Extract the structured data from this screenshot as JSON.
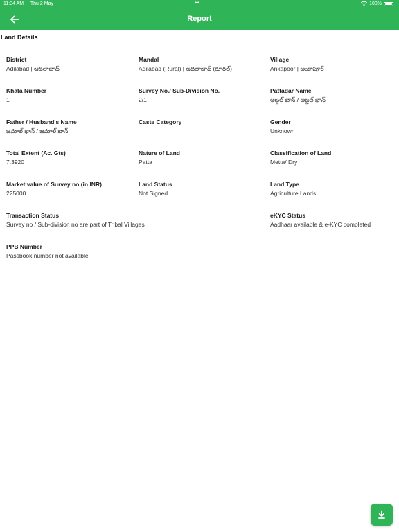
{
  "status_bar": {
    "time": "11:34 AM",
    "date": "Thu 2 May",
    "battery": "100%"
  },
  "header": {
    "title": "Report"
  },
  "section": {
    "title": "Land Details"
  },
  "fields": {
    "district": {
      "label": "District",
      "value": "Adilabad | ఆదిలాబాద్"
    },
    "mandal": {
      "label": "Mandal",
      "value": "Adilabad (Rural) | ఆదిలాబాద్ (రూరల్)"
    },
    "village": {
      "label": "Village",
      "value": "Ankapoor | అంకాపూర్"
    },
    "khata_number": {
      "label": "Khata Number",
      "value": "1"
    },
    "survey_no": {
      "label": "Survey No./ Sub-Division No.",
      "value": "2/1"
    },
    "pattadar_name": {
      "label": "Pattadar Name",
      "value": "అబ్జల్ ఖాన్ / అబ్జల్ ఖాన్"
    },
    "father_husband_name": {
      "label": "Father / Husband's Name",
      "value": "జమాల్ ఖాన్ / జమాల్ ఖాన్"
    },
    "caste_category": {
      "label": "Caste Category",
      "value": ""
    },
    "gender": {
      "label": "Gender",
      "value": "Unknown"
    },
    "total_extent": {
      "label": "Total Extent (Ac. Gts)",
      "value": "7.3920"
    },
    "nature_of_land": {
      "label": "Nature of Land",
      "value": "Patta"
    },
    "classification_of_land": {
      "label": "Classification of Land",
      "value": "Metta/ Dry"
    },
    "market_value": {
      "label": "Market value of Survey no.(in INR)",
      "value": "225000"
    },
    "land_status": {
      "label": "Land Status",
      "value": "Not Signed"
    },
    "land_type": {
      "label": "Land Type",
      "value": "Agriculture Lands"
    },
    "transaction_status": {
      "label": "Transaction Status",
      "value": "Survey no / Sub-division no are part of Tribal Villages"
    },
    "ekyc_status": {
      "label": "eKYC Status",
      "value": "Aadhaar available & e-KYC completed"
    },
    "ppb_number": {
      "label": "PPB Number",
      "value": "Passbook number not available"
    }
  },
  "colors": {
    "accent": "#2fb458",
    "header_text": "#ffffff"
  },
  "icons": {
    "back": "arrow-left-icon",
    "download": "download-icon",
    "wifi": "wifi-icon",
    "battery": "battery-icon"
  }
}
